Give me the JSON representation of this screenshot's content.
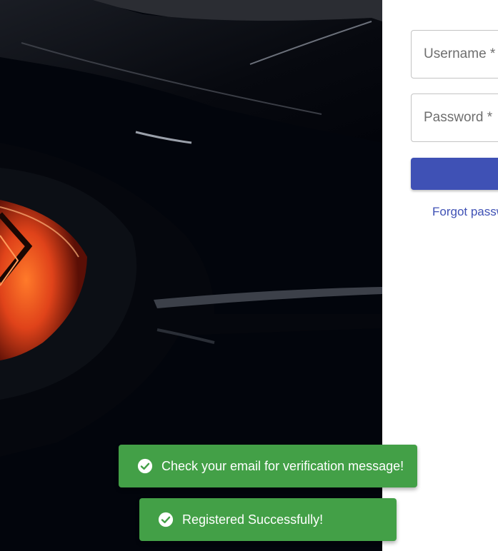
{
  "login_form": {
    "username_placeholder": "Username *",
    "password_placeholder": "Password *",
    "submit_label": "",
    "forgot_password_label": "Forgot password?"
  },
  "notifications": [
    {
      "message": "Check your email for verification message!",
      "icon": "check-circle-icon",
      "status": "success"
    },
    {
      "message": "Registered Successfully!",
      "icon": "check-circle-icon",
      "status": "success"
    }
  ],
  "colors": {
    "primary": "#3f51b5",
    "success": "#43a047",
    "hero_background": "#02050c",
    "taillight": "#ff5a1f"
  }
}
